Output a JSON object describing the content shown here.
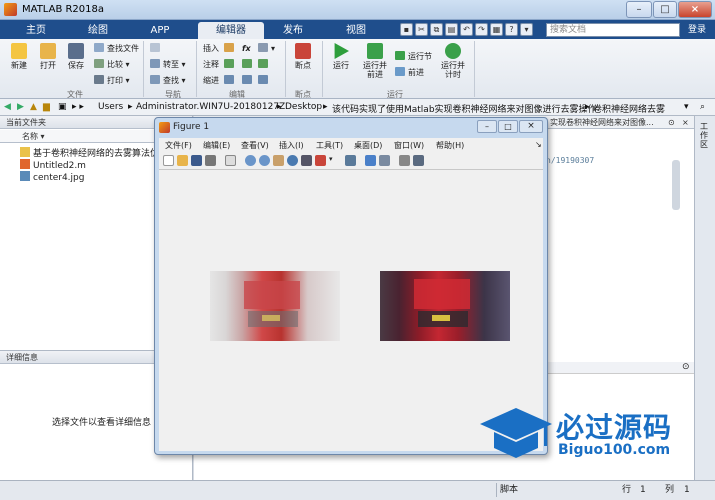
{
  "window": {
    "title": "MATLAB R2018a",
    "min": "–",
    "max": "□",
    "close": "×"
  },
  "tabs": [
    {
      "label": "主页"
    },
    {
      "label": "绘图"
    },
    {
      "label": "APP"
    },
    {
      "label": "编辑器",
      "active": true
    },
    {
      "label": "发布"
    },
    {
      "label": "视图"
    }
  ],
  "search": {
    "placeholder": "搜索文档",
    "login": "登录"
  },
  "ribbon": {
    "new": "新建",
    "open": "打开",
    "save": "保存",
    "find_files": "查找文件",
    "compare": "比较",
    "print": "打印",
    "goto": "转至",
    "find": "查找",
    "insert": "插入",
    "comment": "注释",
    "indent": "缩进",
    "fx": "fx",
    "breakpoints": "断点",
    "run": "运行",
    "run_advance": "运行并\n前进",
    "run_section": "运行节",
    "advance": "前进",
    "run_time": "运行并\n计时",
    "groups": {
      "file": "文件",
      "nav": "导航",
      "edit": "编辑",
      "breakpoints": "断点",
      "run": "运行"
    }
  },
  "address": {
    "segments": [
      "Users",
      "Administrator.WIN7U-20180127Z",
      "Desktop",
      "该代码实现了使用Matlab实现卷积神经网络来对图像进行去雾操作",
      "卷积神经网络去雾"
    ]
  },
  "current_folder": {
    "title": "当前文件夹",
    "name_col": "名称",
    "items": [
      "基于卷积神经网络的去雾算法优化",
      "Untitled2.m",
      "center4.jpg"
    ]
  },
  "details": {
    "title": "详细信息",
    "hint": "选择文件以查看详细信息"
  },
  "cmd": {
    "path_text": "实现卷积神经网络来对图像...",
    "url_text": "n/19190307"
  },
  "workspace_label": "工作区",
  "figure": {
    "title": "Figure 1",
    "menu": [
      "文件(F)",
      "编辑(E)",
      "查看(V)",
      "插入(I)",
      "工具(T)",
      "桌面(D)",
      "窗口(W)",
      "帮助(H)"
    ]
  },
  "status": {
    "script": "脚本",
    "row_label": "行",
    "row": "1",
    "col_label": "列",
    "col": "1"
  },
  "watermark": {
    "brand": "必过源码",
    "url": "Biguo100.com"
  },
  "colors": {
    "tab_bg": "#1f4e8c",
    "accent": "#1f6fbf",
    "watermark": "#1a6fc4"
  }
}
